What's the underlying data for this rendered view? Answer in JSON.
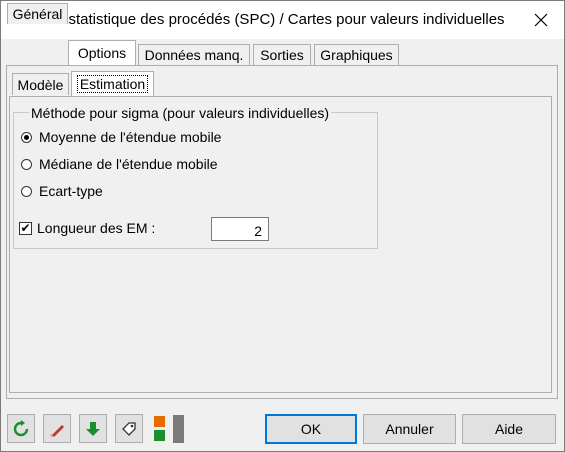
{
  "window": {
    "title": "Maîtrise statistique des procédés (SPC) / Cartes pour valeurs individuelles"
  },
  "tabs": [
    {
      "label": "Général"
    },
    {
      "label": "Options"
    },
    {
      "label": "Données manq."
    },
    {
      "label": "Sorties"
    },
    {
      "label": "Graphiques"
    }
  ],
  "subtabs": [
    {
      "label": "Modèle"
    },
    {
      "label": "Estimation"
    }
  ],
  "sigma_group": {
    "legend": "Méthode pour sigma (pour valeurs individuelles)",
    "options": [
      {
        "label": "Moyenne de l'étendue mobile",
        "selected": true
      },
      {
        "label": "Médiane de l'étendue mobile",
        "selected": false
      },
      {
        "label": "Ecart-type",
        "selected": false
      }
    ]
  },
  "ma_length": {
    "label": "Longueur des EM :",
    "checked": true,
    "value": "2"
  },
  "footer": {
    "icons": [
      "reset-icon",
      "eraser-icon",
      "download-icon",
      "tag-icon",
      "color-swatch-icon"
    ],
    "ok_label": "OK",
    "cancel_label": "Annuler",
    "help_label": "Aide"
  }
}
